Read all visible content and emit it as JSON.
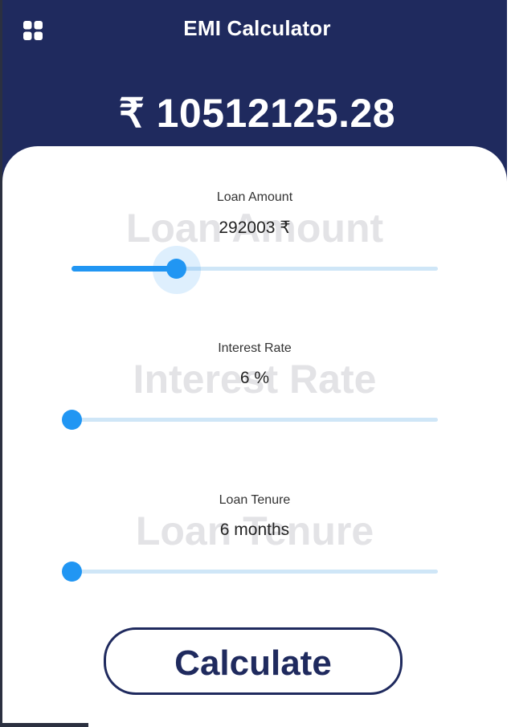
{
  "header": {
    "title": "EMI Calculator",
    "menu_icon": "grid-menu-icon",
    "emi_amount": "₹ 10512125.28"
  },
  "fields": [
    {
      "label": "Loan Amount",
      "watermark": "Loan Amount",
      "value": "292003 ₹",
      "slider_fraction": 0.285,
      "active": true
    },
    {
      "label": "Interest Rate",
      "watermark": "Interest Rate",
      "value": "6 %",
      "slider_fraction": 0.0,
      "active": false
    },
    {
      "label": "Loan Tenure",
      "watermark": "Loan Tenure",
      "value": "6 months",
      "slider_fraction": 0.0,
      "active": false
    }
  ],
  "actions": {
    "calculate_label": "Calculate"
  },
  "colors": {
    "header_bg": "#1f2a5e",
    "accent": "#2196f3",
    "track": "#cfe6f7",
    "button_border": "#1f2a5e"
  }
}
